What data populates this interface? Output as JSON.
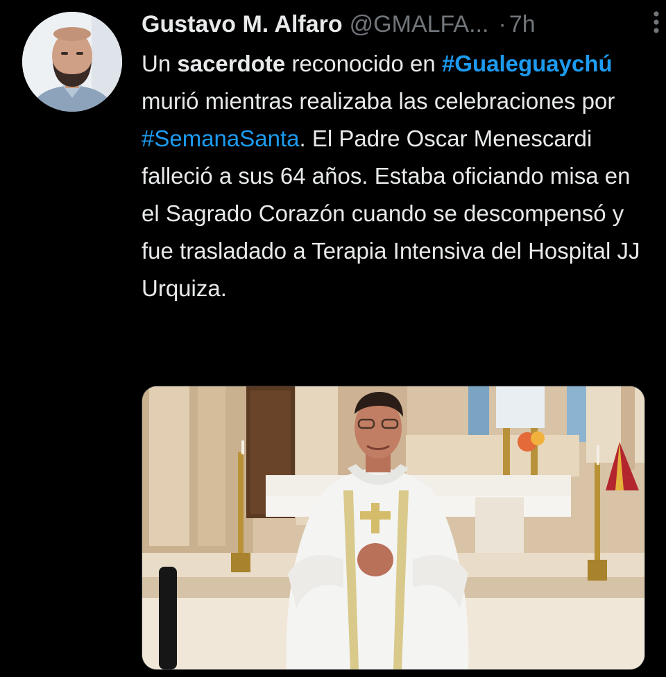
{
  "author": {
    "name": "Gustavo M. Alfaro",
    "handle": "@GMALFA...",
    "separator": "·",
    "time": "7h"
  },
  "tweet": {
    "p1": "Un ",
    "p1_bold": "sacerdote",
    "p2": " reconocido en ",
    "hashtag1": "#Gualeguaychú",
    "p3": " murió mientras realizaba las celebraciones por ",
    "hashtag2": "#SemanaSanta",
    "p4": ". El Padre Oscar Menescardi falleció a sus 64 años. Estaba oficiando misa en el Sagrado Corazón cuando se descompensó y fue trasladado a Terapia Intensiva del Hospital JJ Urquiza."
  },
  "icons": {
    "more": "more-vertical-icon"
  },
  "colors": {
    "background": "#000000",
    "text": "#e7e9ea",
    "secondary": "#71767b",
    "link": "#1d9bf0"
  }
}
